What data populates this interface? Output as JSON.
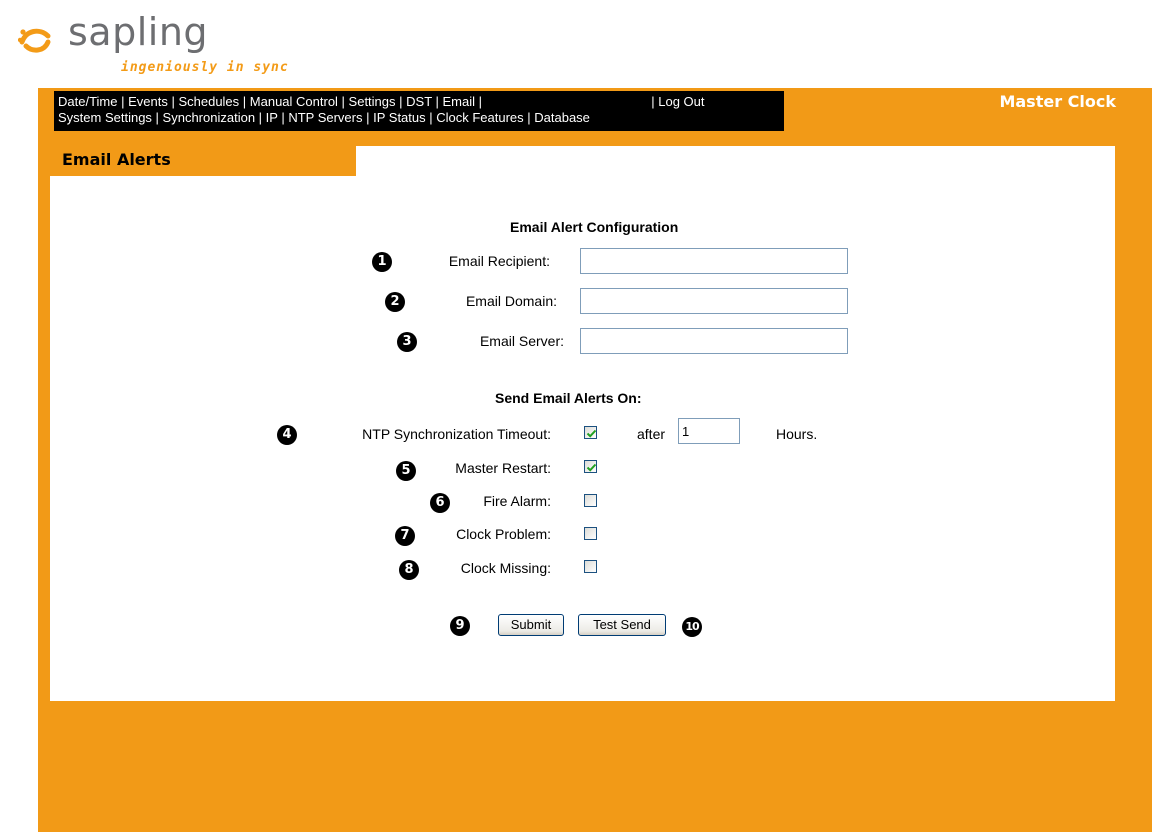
{
  "brand": {
    "name": "sapling",
    "tagline": "ingeniously in sync"
  },
  "header": {
    "app_title": "Master Clock"
  },
  "nav": {
    "row1": [
      "Date/Time",
      "Events",
      "Schedules",
      "Manual Control",
      "Settings",
      "DST",
      "Email"
    ],
    "logout": "Log Out",
    "row2": [
      "System Settings",
      "Synchronization",
      "IP",
      "NTP Servers",
      "IP Status",
      "Clock Features",
      "Database"
    ]
  },
  "section": {
    "title": "Email Alerts"
  },
  "config": {
    "heading": "Email Alert Configuration",
    "fields": [
      {
        "badge": "1",
        "label": "Email Recipient:",
        "value": ""
      },
      {
        "badge": "2",
        "label": "Email Domain:",
        "value": ""
      },
      {
        "badge": "3",
        "label": "Email Server:",
        "value": ""
      }
    ]
  },
  "alerts": {
    "heading": "Send Email Alerts On:",
    "items": [
      {
        "badge": "4",
        "label": "NTP Synchronization Timeout:",
        "checked": true
      },
      {
        "badge": "5",
        "label": "Master Restart:",
        "checked": true
      },
      {
        "badge": "6",
        "label": "Fire Alarm:",
        "checked": false
      },
      {
        "badge": "7",
        "label": "Clock Problem:",
        "checked": false
      },
      {
        "badge": "8",
        "label": "Clock Missing:",
        "checked": false
      }
    ],
    "after_label": "after",
    "after_value": "1",
    "hours_label": "Hours."
  },
  "buttons": {
    "submit_badge": "9",
    "submit": "Submit",
    "test_send": "Test Send",
    "test_send_badge": "10"
  },
  "colors": {
    "brand_orange": "#F29A17",
    "logo_gray": "#6D6E71",
    "check_green": "#21A121"
  }
}
